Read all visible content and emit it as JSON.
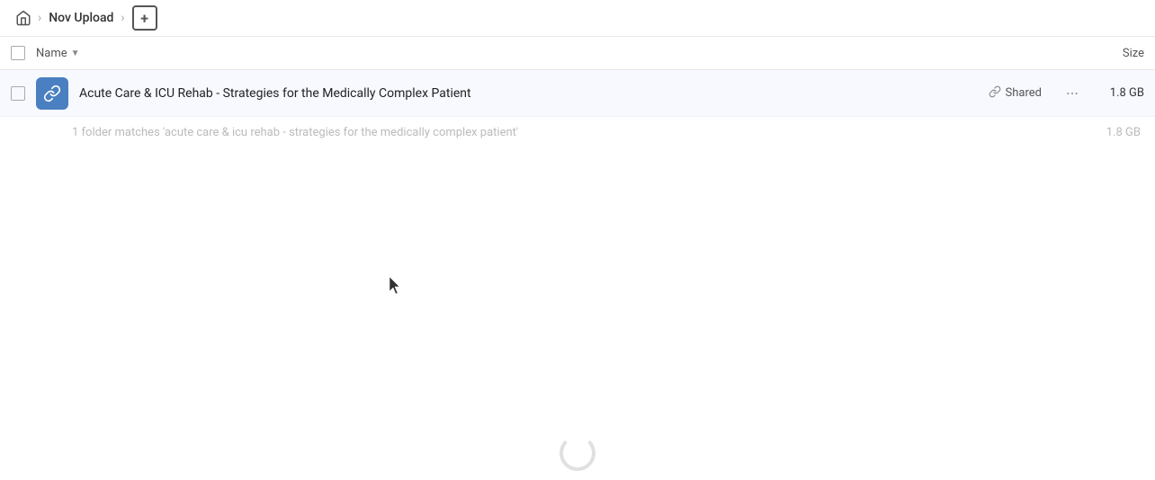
{
  "breadcrumb": {
    "home_label": "Home",
    "separator": "›",
    "folder_name": "Nov Upload",
    "add_button_label": "+"
  },
  "columns": {
    "name_label": "Name",
    "sort_icon": "▼",
    "size_label": "Size"
  },
  "file_row": {
    "name": "Acute Care & ICU Rehab - Strategies for the Medically Complex Patient",
    "shared_label": "Shared",
    "size": "1.8 GB",
    "more_icon": "•••"
  },
  "summary": {
    "text": "1 folder matches 'acute care & icu rehab - strategies for the medically complex patient'",
    "size": "1.8 GB"
  },
  "icons": {
    "home": "⌂",
    "link": "🔗",
    "folder_link": "link-folder"
  }
}
